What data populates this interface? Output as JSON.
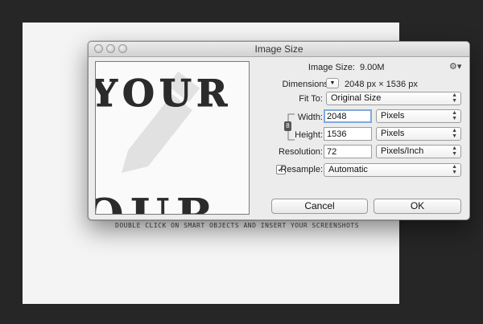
{
  "canvas": {
    "caption": "DOUBLE CLICK ON SMART OBJECTS AND INSERT YOUR SCREENSHOTS",
    "preview_text_top": "YOUR",
    "preview_text_bottom": "OUR"
  },
  "dialog": {
    "title": "Image Size",
    "image_size_label": "Image Size:",
    "image_size_value": "9.00M",
    "dimensions_label": "Dimensions:",
    "dimensions_value": "2048 px  ×  1536 px",
    "fit_to_label": "Fit To:",
    "fit_to_value": "Original Size",
    "width_label": "Width:",
    "width_value": "2048",
    "width_unit": "Pixels",
    "height_label": "Height:",
    "height_value": "1536",
    "height_unit": "Pixels",
    "resolution_label": "Resolution:",
    "resolution_value": "72",
    "resolution_unit": "Pixels/Inch",
    "resample_label": "Resample:",
    "resample_checked": true,
    "resample_value": "Automatic",
    "cancel_label": "Cancel",
    "ok_label": "OK"
  },
  "icons": {
    "gear": "gear-icon",
    "link": "chain-link-icon",
    "dropdown": "chevron-down-icon"
  }
}
